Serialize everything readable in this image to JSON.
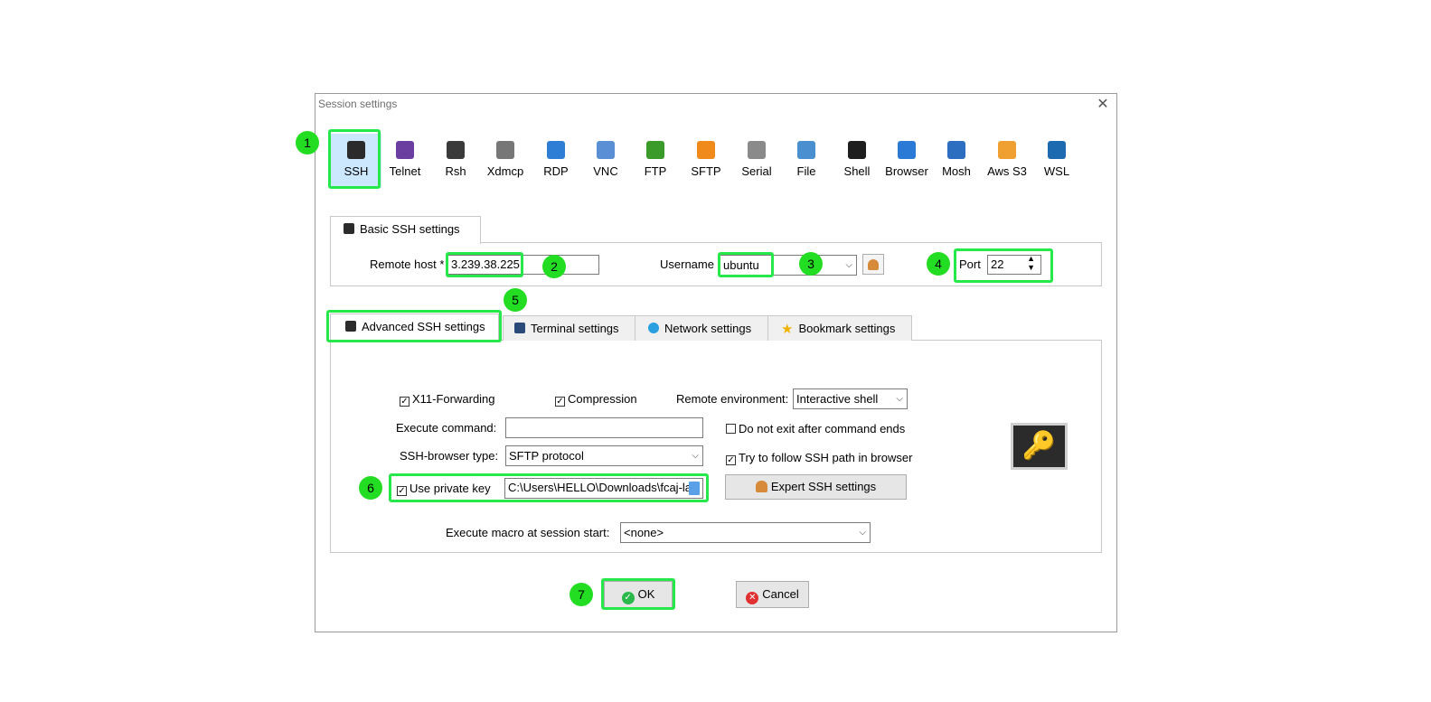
{
  "window": {
    "title": "Session settings",
    "close_glyph": "✕"
  },
  "protocols": [
    {
      "label": "SSH",
      "icon": "ssh-icon",
      "color": "#2b2b2b"
    },
    {
      "label": "Telnet",
      "icon": "telnet-icon",
      "color": "#6a3fa0"
    },
    {
      "label": "Rsh",
      "icon": "rsh-icon",
      "color": "#3a3a3a"
    },
    {
      "label": "Xdmcp",
      "icon": "xdmcp-icon",
      "color": "#777777"
    },
    {
      "label": "RDP",
      "icon": "rdp-icon",
      "color": "#2e7ed6"
    },
    {
      "label": "VNC",
      "icon": "vnc-icon",
      "color": "#5a8fd6"
    },
    {
      "label": "FTP",
      "icon": "ftp-icon",
      "color": "#3a9a2a"
    },
    {
      "label": "SFTP",
      "icon": "sftp-icon",
      "color": "#f08a1a"
    },
    {
      "label": "Serial",
      "icon": "serial-icon",
      "color": "#8a8a8a"
    },
    {
      "label": "File",
      "icon": "file-icon",
      "color": "#4a8fd0"
    },
    {
      "label": "Shell",
      "icon": "shell-icon",
      "color": "#1e1e1e"
    },
    {
      "label": "Browser",
      "icon": "browser-icon",
      "color": "#2a7ad6"
    },
    {
      "label": "Mosh",
      "icon": "mosh-icon",
      "color": "#2e6ec0"
    },
    {
      "label": "Aws S3",
      "icon": "aws-s3-icon",
      "color": "#f0a030"
    },
    {
      "label": "WSL",
      "icon": "wsl-icon",
      "color": "#1e6ab0"
    }
  ],
  "basic": {
    "tab_label": "Basic SSH settings",
    "remote_host_label": "Remote host *",
    "remote_host_value": "3.239.38.225",
    "username_label": "Username",
    "username_value": "ubuntu",
    "port_label": "Port",
    "port_value": "22"
  },
  "adv_tabs": [
    "Advanced SSH settings",
    "Terminal settings",
    "Network settings",
    "Bookmark settings"
  ],
  "advanced": {
    "x11_label": "X11-Forwarding",
    "compression_label": "Compression",
    "remote_env_label": "Remote environment:",
    "remote_env_value": "Interactive shell",
    "exec_cmd_label": "Execute command:",
    "exec_cmd_value": "",
    "no_exit_label": "Do not exit after command ends",
    "browser_type_label": "SSH-browser type:",
    "browser_type_value": "SFTP protocol",
    "follow_path_label": "Try to follow SSH path in browser",
    "private_key_label": "Use private key",
    "private_key_value": "C:\\Users\\HELLO\\Downloads\\fcaj-la",
    "expert_label": "Expert SSH settings",
    "macro_label": "Execute macro at session start:",
    "macro_value": "<none>"
  },
  "buttons": {
    "ok": "OK",
    "cancel": "Cancel"
  },
  "badges": [
    "1",
    "2",
    "3",
    "4",
    "5",
    "6",
    "7"
  ],
  "colors": {
    "highlight": "#27e84a",
    "badge": "#22dd22",
    "selected_bg": "#cce8ff"
  }
}
